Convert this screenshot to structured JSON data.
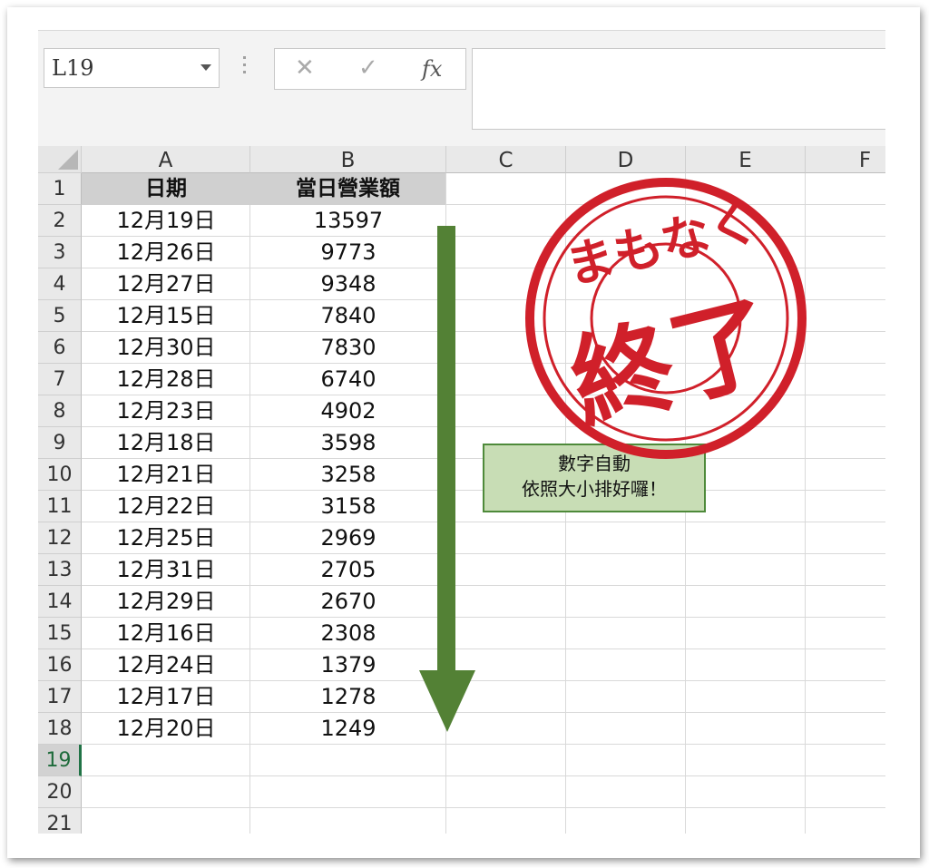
{
  "namebox": {
    "value": "L19"
  },
  "formula_buttons": {
    "cancel": "✕",
    "enter": "✓",
    "function": "fx"
  },
  "columns": [
    "A",
    "B",
    "C",
    "D",
    "E",
    "F"
  ],
  "row_numbers": [
    "1",
    "2",
    "3",
    "4",
    "5",
    "6",
    "7",
    "8",
    "9",
    "10",
    "11",
    "12",
    "13",
    "14",
    "15",
    "16",
    "17",
    "18",
    "19",
    "20",
    "21"
  ],
  "selected_row": "19",
  "headers": {
    "date": "日期",
    "sales": "當日營業額"
  },
  "rows": [
    {
      "date": "12月19日",
      "sales": "13597"
    },
    {
      "date": "12月26日",
      "sales": "9773"
    },
    {
      "date": "12月27日",
      "sales": "9348"
    },
    {
      "date": "12月15日",
      "sales": "7840"
    },
    {
      "date": "12月30日",
      "sales": "7830"
    },
    {
      "date": "12月28日",
      "sales": "6740"
    },
    {
      "date": "12月23日",
      "sales": "4902"
    },
    {
      "date": "12月18日",
      "sales": "3598"
    },
    {
      "date": "12月21日",
      "sales": "3258"
    },
    {
      "date": "12月22日",
      "sales": "3158"
    },
    {
      "date": "12月25日",
      "sales": "2969"
    },
    {
      "date": "12月31日",
      "sales": "2705"
    },
    {
      "date": "12月29日",
      "sales": "2670"
    },
    {
      "date": "12月16日",
      "sales": "2308"
    },
    {
      "date": "12月24日",
      "sales": "1379"
    },
    {
      "date": "12月17日",
      "sales": "1278"
    },
    {
      "date": "12月20日",
      "sales": "1249"
    }
  ],
  "note": {
    "line1": "數字自動",
    "line2": "依照大小排好囉！"
  },
  "stamp": {
    "top_text": "まもなく",
    "main_text": "終了"
  },
  "colors": {
    "arrow": "#538135",
    "note_bg": "#c8ddb5",
    "stamp_red": "#d0202a",
    "selected_row": "#217346"
  }
}
